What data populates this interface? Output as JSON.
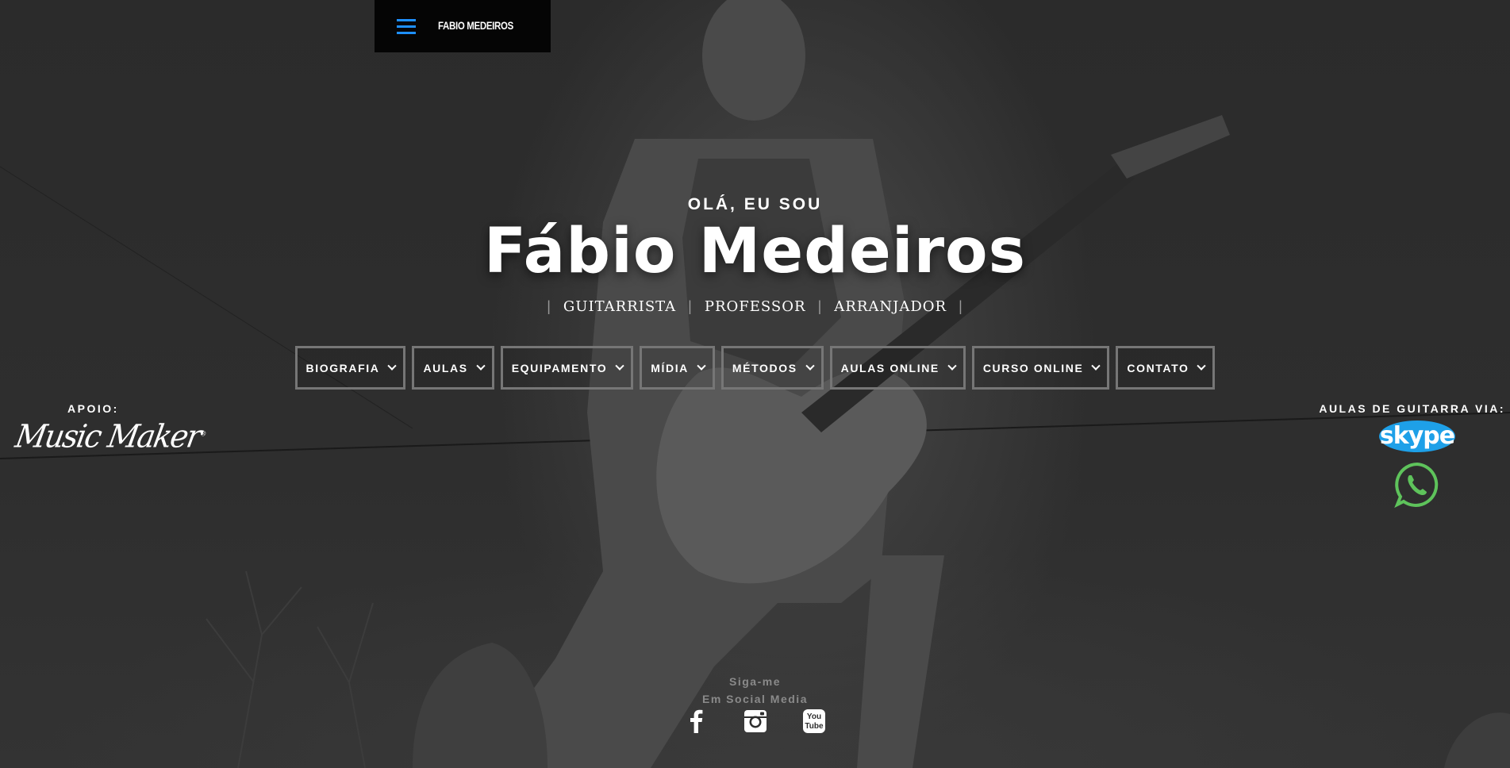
{
  "header": {
    "site_name": "FABIO MEDEIROS",
    "menu_icon": "hamburger-menu-icon"
  },
  "hero": {
    "greeting": "OLÁ, EU SOU",
    "name": "Fábio Medeiros",
    "roles": [
      "GUITARRISTA",
      "PROFESSOR",
      "ARRANJADOR"
    ],
    "separator": "|"
  },
  "nav": {
    "items": [
      {
        "label": "BIOGRAFIA"
      },
      {
        "label": "AULAS"
      },
      {
        "label": "EQUIPAMENTO"
      },
      {
        "label": "MÍDIA"
      },
      {
        "label": "MÉTODOS"
      },
      {
        "label": "AULAS ONLINE"
      },
      {
        "label": "CURSO ONLINE"
      },
      {
        "label": "CONTATO"
      }
    ]
  },
  "sponsor": {
    "label": "APOIO:",
    "logo_text": "Music Maker",
    "trademark": "®"
  },
  "lessons": {
    "label": "AULAS DE GUITARRA VIA:",
    "skype_text": "skype",
    "skype_color": "#1ea0e8",
    "whatsapp_color": "#5ec35b"
  },
  "social": {
    "line1": "Siga-me",
    "line2": "Em Social Media",
    "icons": [
      "facebook-icon",
      "instagram-icon",
      "youtube-icon"
    ],
    "youtube_top": "You",
    "youtube_bottom": "Tube"
  },
  "colors": {
    "accent": "#1e90ff",
    "nav_border": "#767676",
    "muted_text": "#8a8a8a"
  }
}
